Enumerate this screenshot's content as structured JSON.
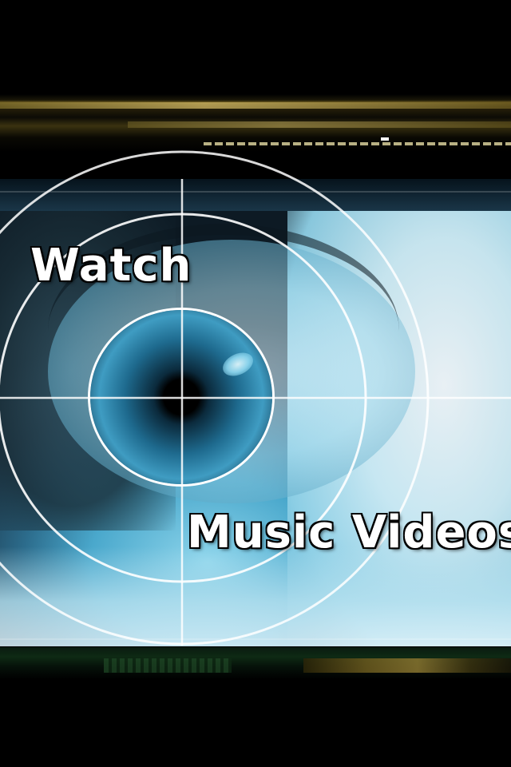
{
  "splash": {
    "headline_top": "Watch",
    "headline_bottom": "Music Videos"
  },
  "colors": {
    "iris_blue": "#3f9cc2",
    "highlight": "#ffffff",
    "band_gold": "#8a7630"
  },
  "icons": {
    "crosshair": "target-reticle-icon"
  }
}
